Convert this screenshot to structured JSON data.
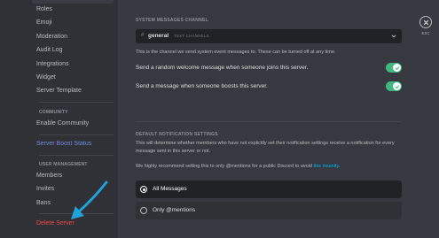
{
  "sidebar": {
    "items": [
      {
        "label": "Roles"
      },
      {
        "label": "Emoji"
      },
      {
        "label": "Moderation"
      },
      {
        "label": "Audit Log"
      },
      {
        "label": "Integrations"
      },
      {
        "label": "Widget"
      },
      {
        "label": "Server Template"
      }
    ],
    "community_header": "COMMUNITY",
    "community_items": [
      {
        "label": "Enable Community"
      }
    ],
    "boost_status": "Server Boost Status",
    "user_mgmt_header": "USER MANAGEMENT",
    "user_mgmt_items": [
      {
        "label": "Members"
      },
      {
        "label": "Invites"
      },
      {
        "label": "Bans"
      }
    ],
    "delete_server": "Delete Server"
  },
  "system_messages": {
    "header": "SYSTEM MESSAGES CHANNEL",
    "channel_prefix": "#",
    "channel_name": "general",
    "channel_category": "TEXT CHANNELS",
    "hint": "This is the channel we send system event messages to. These can be turned off at any time.",
    "welcome_label": "Send a random welcome message when someone joins this server.",
    "welcome_enabled": true,
    "boost_label": "Send a message when someone boosts this server.",
    "boost_enabled": true
  },
  "notifications": {
    "header": "DEFAULT NOTIFICATION SETTINGS",
    "description": "This will determine whether members who have not explicitly set their notification settings receive a notification for every message sent in this server or not.",
    "recommendation_prefix": "We highly recommend setting this to only @mentions for a public Discord to avoid ",
    "recommendation_link": "this insanity",
    "recommendation_suffix": ".",
    "options": [
      {
        "label": "All Messages",
        "selected": true
      },
      {
        "label": "Only @mentions",
        "selected": false
      }
    ]
  },
  "close": {
    "label": "ESC"
  },
  "colors": {
    "accent_green": "#43b581",
    "danger": "#f04747",
    "link": "#00b0f4",
    "blurple": "#7289da",
    "annotation_arrow": "#1fa4d9"
  }
}
